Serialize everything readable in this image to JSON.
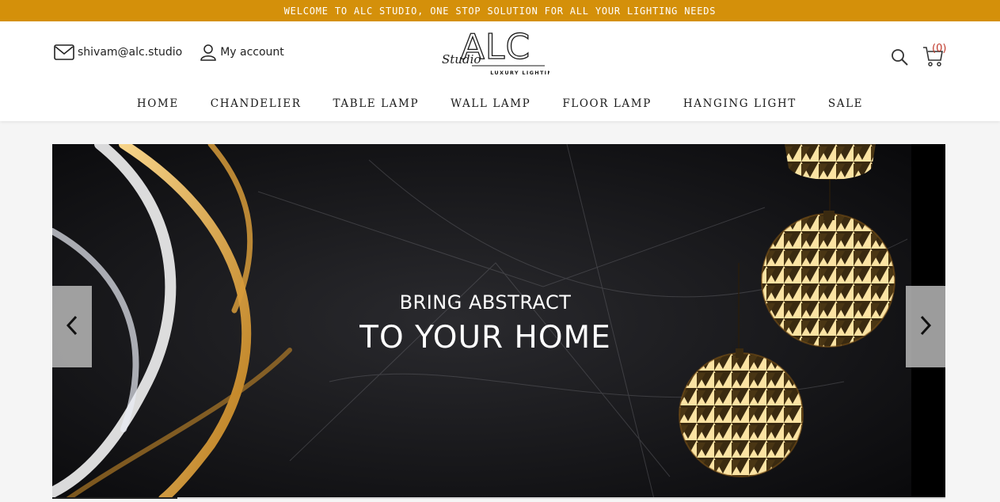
{
  "topbar": {
    "text": "WELCOME TO ALC STUDIO, ONE STOP SOLUTION FOR ALL YOUR LIGHTING NEEDS",
    "bg_color": "#d4900a"
  },
  "header": {
    "email": "shivam@alc.studio",
    "account_label": "My account",
    "logo": {
      "main": "ALC",
      "script": "Studio",
      "tagline": "LUXURY LIGHTING"
    },
    "cart_count": "(0)",
    "icons": [
      "mail-icon",
      "user-icon",
      "search-icon",
      "cart-icon"
    ]
  },
  "nav": {
    "items": [
      {
        "label": "HOME"
      },
      {
        "label": "CHANDELIER"
      },
      {
        "label": "TABLE LAMP"
      },
      {
        "label": "WALL LAMP"
      },
      {
        "label": "FLOOR LAMP"
      },
      {
        "label": "HANGING LIGHT"
      },
      {
        "label": "SALE"
      }
    ]
  },
  "slider": {
    "line1": "BRING ABSTRACT",
    "line2": "TO YOUR HOME",
    "prev_icon": "chevron-left-icon",
    "next_icon": "chevron-right-icon",
    "progress": 0.14
  }
}
